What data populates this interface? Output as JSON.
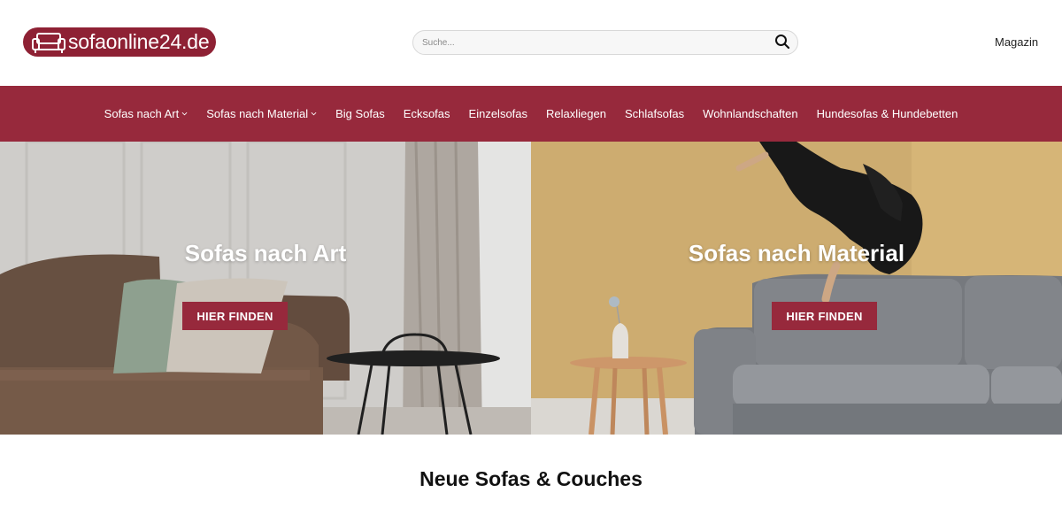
{
  "header": {
    "logo_text": "sofaonline24.de",
    "logo_icon": "sofa-icon",
    "search_placeholder": "Suche...",
    "search_icon": "search-icon",
    "magazin_label": "Magazin"
  },
  "nav": {
    "items": [
      {
        "label": "Sofas nach Art",
        "has_dropdown": true
      },
      {
        "label": "Sofas nach Material",
        "has_dropdown": true
      },
      {
        "label": "Big Sofas",
        "has_dropdown": false
      },
      {
        "label": "Ecksofas",
        "has_dropdown": false
      },
      {
        "label": "Einzelsofas",
        "has_dropdown": false
      },
      {
        "label": "Relaxliegen",
        "has_dropdown": false
      },
      {
        "label": "Schlafsofas",
        "has_dropdown": false
      },
      {
        "label": "Wohnlandschaften",
        "has_dropdown": false
      },
      {
        "label": "Hundesofas & Hundebetten",
        "has_dropdown": false
      }
    ]
  },
  "hero": {
    "left": {
      "title": "Sofas nach Art",
      "button_label": "HIER FINDEN"
    },
    "right": {
      "title": "Sofas nach Material",
      "button_label": "HIER FINDEN"
    }
  },
  "section": {
    "title": "Neue Sofas & Couches"
  },
  "colors": {
    "brand": "#97293c",
    "logo_bg": "#8e2134",
    "nav_text": "#ffffff"
  }
}
